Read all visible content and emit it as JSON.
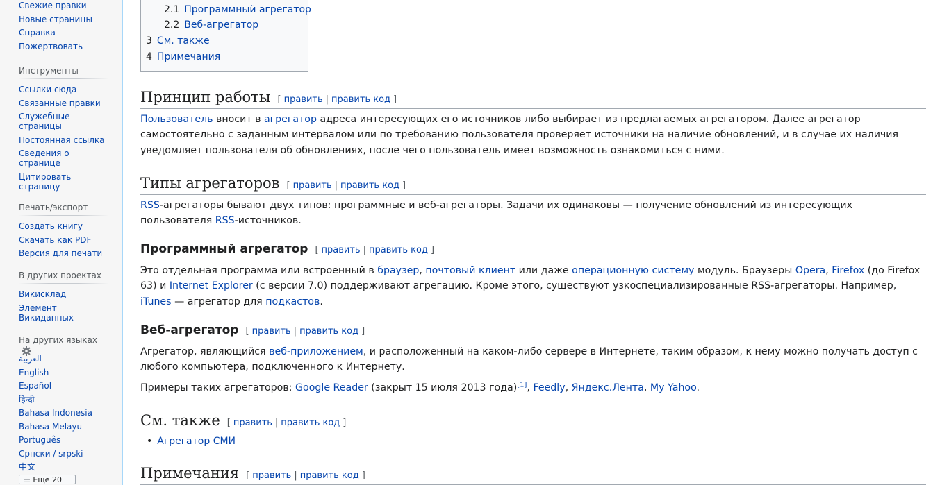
{
  "sidebar": {
    "top_links": [
      "Свежие правки",
      "Новые страницы",
      "Справка",
      "Пожертвовать"
    ],
    "tools": {
      "heading": "Инструменты",
      "links": [
        "Ссылки сюда",
        "Связанные правки",
        "Служебные страницы",
        "Постоянная ссылка",
        "Сведения о странице",
        "Цитировать страницу"
      ]
    },
    "print": {
      "heading": "Печать/экспорт",
      "links": [
        "Создать книгу",
        "Скачать как PDF",
        "Версия для печати"
      ]
    },
    "projects": {
      "heading": "В других проектах",
      "links": [
        "Викисклад",
        "Элемент Викиданных"
      ]
    },
    "languages": {
      "heading": "На других языках",
      "links": [
        "العربية",
        "English",
        "Español",
        "हिन्दी",
        "Bahasa Indonesia",
        "Bahasa Melayu",
        "Português",
        "Српски / srpski",
        "中文"
      ],
      "edit_links_button": "Ещё 20"
    }
  },
  "toc": {
    "items": [
      {
        "num": "2.1",
        "label": "Программный агрегатор"
      },
      {
        "num": "2.2",
        "label": "Веб-агрегатор"
      },
      {
        "num": "3",
        "label": "См. также"
      },
      {
        "num": "4",
        "label": "Примечания"
      }
    ]
  },
  "edit": {
    "edit": "править",
    "edit_code": "править код",
    "open": "[",
    "close": "]",
    "sep": "|"
  },
  "sections": {
    "principle": {
      "title": "Принцип работы",
      "p": [
        {
          "t": "Пользователь",
          "link": true
        },
        {
          "t": " вносит в "
        },
        {
          "t": "агрегатор",
          "link": true
        },
        {
          "t": " адреса интересующих его источников либо выбирает из предлагаемых агрегатором. Далее агрегатор самостоятельно с заданным интервалом или по требованию пользователя проверяет источники на наличие обновлений, и в случае их наличия уведомляет пользователя об обновлениях, после чего пользователь имеет возможность ознакомиться с ними."
        }
      ]
    },
    "types": {
      "title": "Типы агрегаторов",
      "p": [
        {
          "t": "RSS",
          "link": true
        },
        {
          "t": "-агрегаторы бывают двух типов: программные и веб-агрегаторы. Задачи их одинаковы — получение обновлений из интересующих пользователя "
        },
        {
          "t": "RSS",
          "link": true
        },
        {
          "t": "-источников."
        }
      ]
    },
    "software": {
      "title": "Программный агрегатор",
      "p": [
        {
          "t": "Это отдельная программа или встроенный в "
        },
        {
          "t": "браузер",
          "link": true
        },
        {
          "t": ", "
        },
        {
          "t": "почтовый клиент",
          "link": true
        },
        {
          "t": " или даже "
        },
        {
          "t": "операционную систему",
          "link": true
        },
        {
          "t": " модуль. Браузеры "
        },
        {
          "t": "Opera",
          "link": true
        },
        {
          "t": ", "
        },
        {
          "t": "Firefox",
          "link": true
        },
        {
          "t": " (до Firefox 63) и "
        },
        {
          "t": "Internet Explorer",
          "link": true
        },
        {
          "t": " (с версии 7.0) поддерживают агрегацию. Кроме этого, существуют узкоспециализированные RSS-агрегаторы. Например, "
        },
        {
          "t": "iTunes",
          "link": true
        },
        {
          "t": " — агрегатор для "
        },
        {
          "t": "подкастов",
          "link": true
        },
        {
          "t": "."
        }
      ]
    },
    "web": {
      "title": "Веб-агрегатор",
      "p1": [
        {
          "t": "Агрегатор, являющийся "
        },
        {
          "t": "веб-приложением",
          "link": true
        },
        {
          "t": ", и расположенный на каком-либо сервере в Интернете, таким образом, к нему можно получать доступ с любого компьютера, подключенного к Интернету."
        }
      ],
      "p2": [
        {
          "t": "Примеры таких агрегаторов: "
        },
        {
          "t": "Google Reader",
          "link": true
        },
        {
          "t": " (закрыт 15 июля 2013 года)"
        },
        {
          "t": "[1]",
          "link": true,
          "sup": true
        },
        {
          "t": ", "
        },
        {
          "t": "Feedly",
          "link": true
        },
        {
          "t": ", "
        },
        {
          "t": "Яндекс.Лента",
          "link": true
        },
        {
          "t": ", "
        },
        {
          "t": "My Yahoo",
          "link": true
        },
        {
          "t": "."
        }
      ]
    },
    "seealso": {
      "title": "См. также",
      "items": [
        "Агрегатор СМИ"
      ]
    },
    "notes": {
      "title": "Примечания"
    }
  },
  "colors": {
    "link": "#0645ad",
    "text": "#202122",
    "muted": "#54595d",
    "border": "#a2a9b1"
  }
}
